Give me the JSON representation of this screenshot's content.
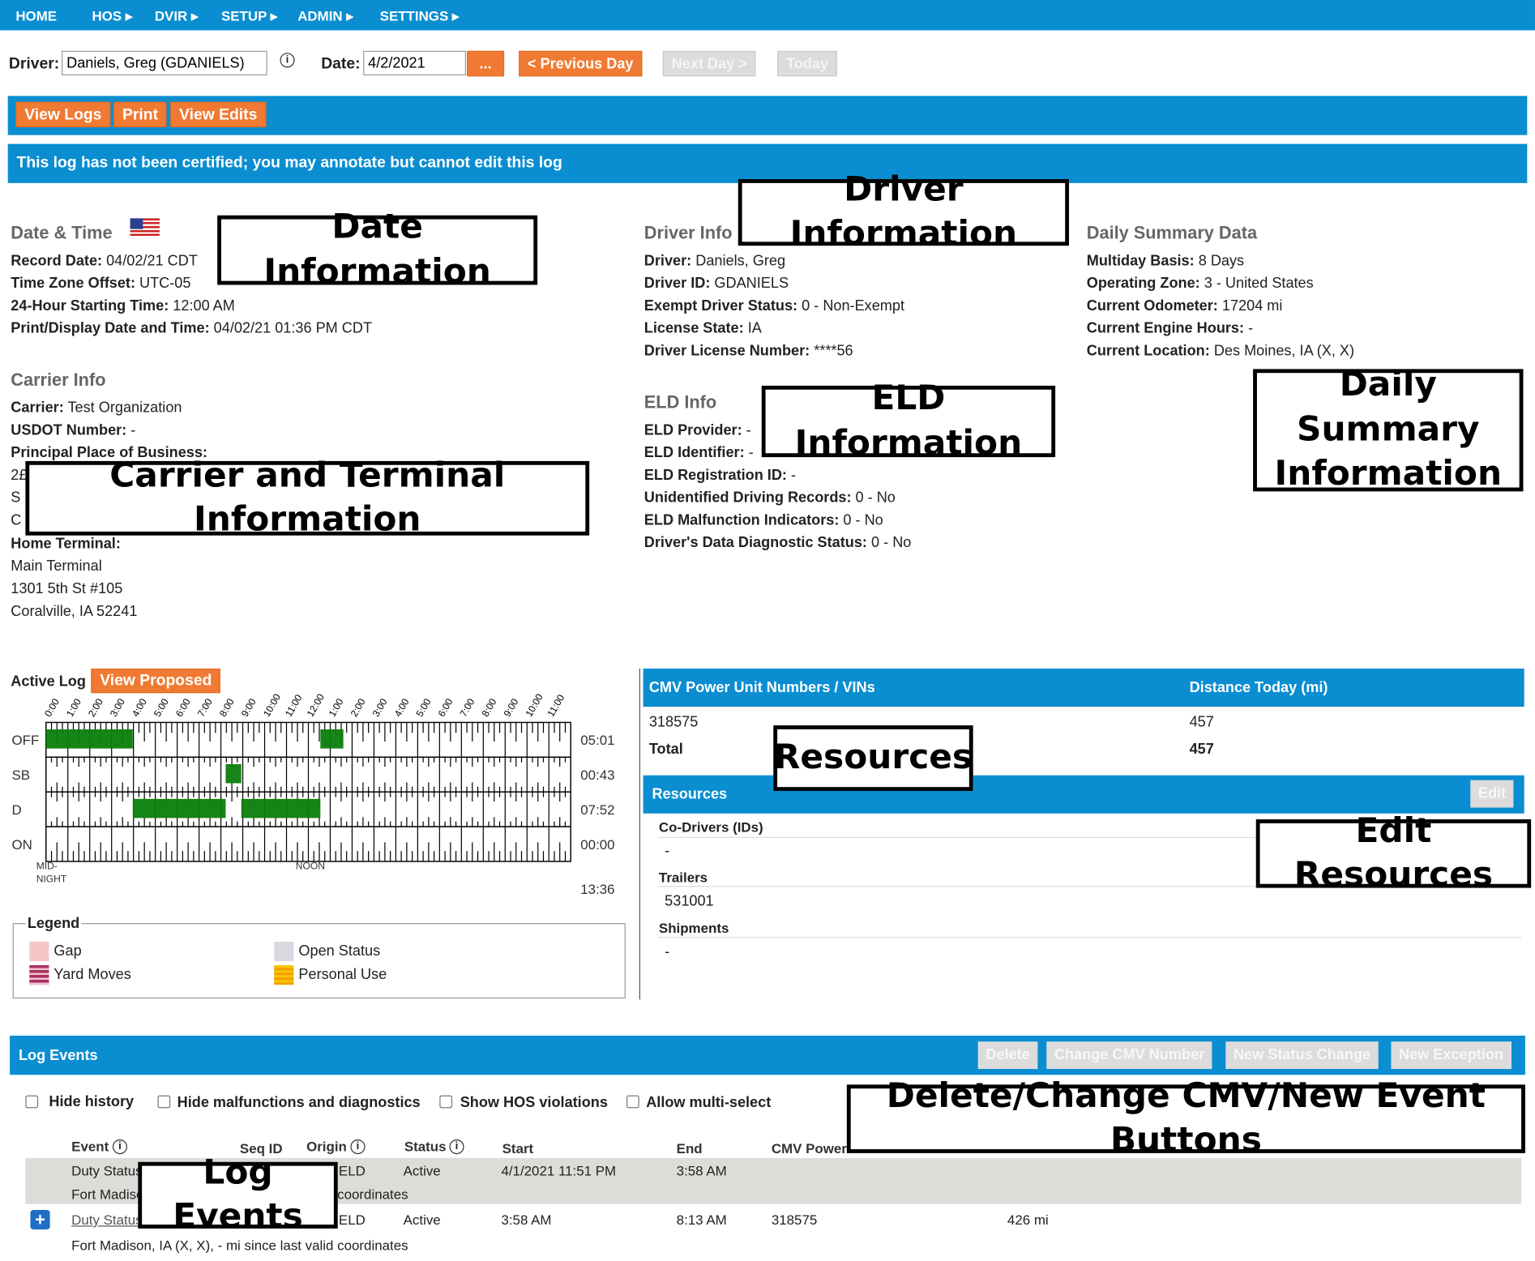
{
  "nav": {
    "items": [
      "HOME",
      "HOS ▸",
      "DVIR ▸",
      "SETUP ▸",
      "ADMIN ▸",
      "SETTINGS ▸"
    ]
  },
  "toolbar": {
    "driver_label": "Driver:",
    "driver_value": "Daniels, Greg (GDANIELS)",
    "date_label": "Date:",
    "date_value": "4/2/2021",
    "picker": "...",
    "prev": "< Previous Day",
    "next": "Next Day >",
    "today": "Today"
  },
  "actions": {
    "view_logs": "View Logs",
    "print": "Print",
    "view_edits": "View Edits"
  },
  "notice": "This log has not been certified; you may annotate but cannot edit this log",
  "date_time": {
    "heading": "Date & Time",
    "rows": [
      [
        "Record Date:",
        "04/02/21 CDT"
      ],
      [
        "Time Zone Offset:",
        "UTC-05"
      ],
      [
        "24-Hour Starting Time:",
        "12:00 AM"
      ],
      [
        "Print/Display Date and Time:",
        "04/02/21 01:36 PM CDT"
      ]
    ]
  },
  "carrier": {
    "heading": "Carrier Info",
    "rows": [
      [
        "Carrier:",
        "Test Organization"
      ],
      [
        "USDOT Number:",
        "-"
      ],
      [
        "Principal Place of Business:",
        ""
      ]
    ],
    "partial": [
      "2£",
      "S",
      "C"
    ],
    "home_terminal_label": "Home Terminal:",
    "terminal": [
      "Main Terminal",
      "1301 5th St #105",
      "Coralville, IA 52241"
    ]
  },
  "driver_info": {
    "heading": "Driver Info",
    "rows": [
      [
        "Driver:",
        "Daniels, Greg"
      ],
      [
        "Driver ID:",
        "GDANIELS"
      ],
      [
        "Exempt Driver Status:",
        "0 - Non-Exempt"
      ],
      [
        "License State:",
        "IA"
      ],
      [
        "Driver License Number:",
        "****56"
      ]
    ]
  },
  "eld_info": {
    "heading": "ELD Info",
    "rows": [
      [
        "ELD Provider:",
        "-"
      ],
      [
        "ELD Identifier:",
        "-"
      ],
      [
        "ELD Registration ID:",
        "-"
      ],
      [
        "Unidentified Driving Records:",
        "0 - No"
      ],
      [
        "ELD Malfunction Indicators:",
        "0 - No"
      ],
      [
        "Driver's Data Diagnostic Status:",
        "0 - No"
      ]
    ]
  },
  "daily_summary": {
    "heading": "Daily Summary Data",
    "rows": [
      [
        "Multiday Basis:",
        "8 Days"
      ],
      [
        "Operating Zone:",
        "3 - United States"
      ],
      [
        "Current Odometer:",
        "17204 mi"
      ],
      [
        "Current Engine Hours:",
        "-"
      ],
      [
        "Current Location:",
        "Des Moines, IA (X, X)"
      ]
    ]
  },
  "annotations": {
    "date": "Date Information",
    "driver": "Driver Information",
    "eld": "ELD Information",
    "daily": "Daily Summary Information",
    "carrier": "Carrier and Terminal Information",
    "resources": "Resources",
    "edit_resources": "Edit Resources",
    "buttons": "Delete/Change CMV/New Event Buttons",
    "log_events": "Log Events"
  },
  "graph": {
    "title": "Active Log",
    "view_proposed": "View Proposed",
    "hours": [
      "0:00",
      "1:00",
      "2:00",
      "3:00",
      "4:00",
      "5:00",
      "6:00",
      "7:00",
      "8:00",
      "9:00",
      "10:00",
      "11:00",
      "12:00",
      "1:00",
      "2:00",
      "3:00",
      "4:00",
      "5:00",
      "6:00",
      "7:00",
      "8:00",
      "9:00",
      "10:00",
      "11:00"
    ],
    "rows": [
      {
        "label": "OFF",
        "total": "05:01"
      },
      {
        "label": "SB",
        "total": "00:43"
      },
      {
        "label": "D",
        "total": "07:52"
      },
      {
        "label": "ON",
        "total": "00:00"
      }
    ],
    "segments": [
      {
        "row": 0,
        "start": 0,
        "end": 3.967
      },
      {
        "row": 2,
        "start": 3.967,
        "end": 8.217
      },
      {
        "row": 1,
        "start": 8.217,
        "end": 8.933
      },
      {
        "row": 2,
        "start": 8.933,
        "end": 12.55
      },
      {
        "row": 0,
        "start": 12.55,
        "end": 13.6
      }
    ],
    "midnight": [
      "MID-",
      "NIGHT"
    ],
    "noon": "NOON",
    "grand_total": "13:36",
    "color": "#0a7d0a"
  },
  "legend": {
    "title": "Legend",
    "items": [
      {
        "label": "Gap",
        "color": "#f4c6c6"
      },
      {
        "label": "Open Status",
        "color": "#d8d8e0"
      },
      {
        "label": "Yard Moves",
        "color": "#a8315f"
      },
      {
        "label": "Personal Use",
        "color": "#f5c400"
      }
    ]
  },
  "cmv": {
    "col1": "CMV Power Unit Numbers / VINs",
    "col2": "Distance Today (mi)",
    "rows": [
      [
        "318575",
        "457"
      ]
    ],
    "total_label": "Total",
    "total": "457"
  },
  "resources": {
    "title": "Resources",
    "edit": "Edit",
    "codrivers_label": "Co-Drivers (IDs)",
    "codrivers": "-",
    "trailers_label": "Trailers",
    "trailers": "531001",
    "shipments_label": "Shipments",
    "shipments": "-"
  },
  "log_events": {
    "title": "Log Events",
    "buttons": [
      "Delete",
      "Change CMV Number",
      "New Status Change",
      "New Exception"
    ],
    "filters": [
      "Hide history",
      "Hide malfunctions and diagnostics",
      "Show HOS violations",
      "Allow multi-select"
    ],
    "columns": [
      "Event",
      "Seq ID",
      "Origin",
      "Status",
      "Start",
      "End",
      "CMV Power"
    ],
    "rows": [
      {
        "event": "Duty Status",
        "origin": "ELD",
        "status": "Active",
        "start": "4/1/2021 11:51 PM",
        "end": "3:58 AM",
        "cmv": "",
        "dist": "",
        "sub": "Fort Madison, IA (X, X), - mi since last valid coordinates"
      },
      {
        "event": "Duty Status",
        "origin": "ELD",
        "status": "Active",
        "start": "3:58 AM",
        "end": "8:13 AM",
        "cmv": "318575",
        "dist": "426 mi",
        "sub": "Fort Madison, IA (X, X), - mi since last valid coordinates"
      }
    ]
  }
}
